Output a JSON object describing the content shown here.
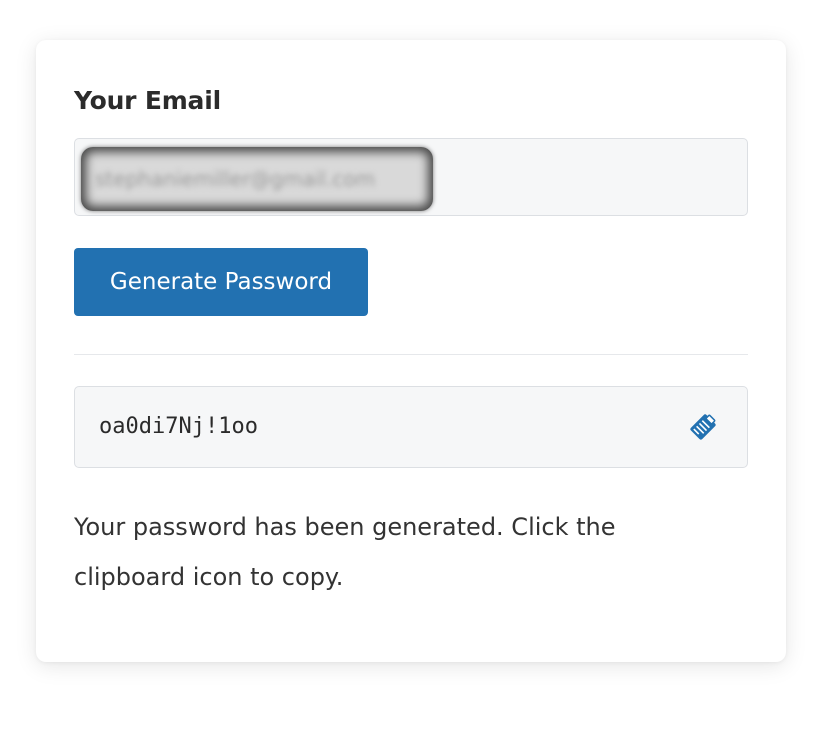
{
  "form": {
    "email_label": "Your Email",
    "email_value": "stephaniemiller@gmail.com",
    "generate_button_label": "Generate Password",
    "password_value": "oa0di7Nj!1oo",
    "copy_icon": "clipboard-icon",
    "status_message": "Your password has been generated. Click the clipboard icon to copy."
  },
  "colors": {
    "accent": "#2271b1",
    "field_background": "#f6f7f8",
    "text": "#2b2b2b"
  }
}
